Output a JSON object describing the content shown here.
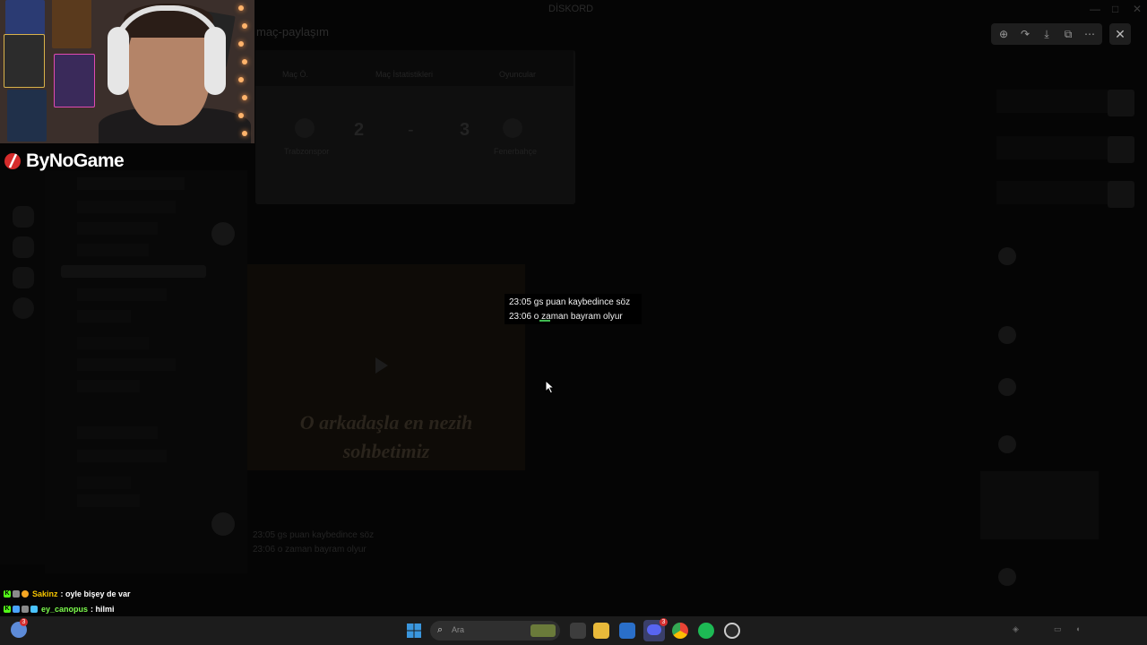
{
  "window": {
    "title": "DİSKORD"
  },
  "main": {
    "channel_header": "maç-paylaşım",
    "embed": {
      "tabs": [
        "Maç Ö.",
        "Maç İstatistikleri",
        "Oyuncular"
      ],
      "home_score": "2",
      "separator": "-",
      "away_score": "3",
      "home_team": "Trabzonspor",
      "away_team": "Fenerbahçe"
    },
    "video_caption_line1": "O arkadaşla en nezih",
    "video_caption_line2": "sohbetimiz",
    "dim_messages": [
      "23:05 gs puan kaybedince söz",
      "23:06 o zaman bayram olyur"
    ]
  },
  "tooltip": {
    "line1": "23:05 gs puan kaybedince söz",
    "line2": "23:06 o zaman bayram olyur"
  },
  "viewer_toolbar": {
    "icons": [
      "zoom-in-icon",
      "share-icon",
      "download-icon",
      "open-external-icon",
      "more-icon"
    ],
    "close_icon": "close-icon"
  },
  "overlay": {
    "brand": "ByNoGame"
  },
  "chat": [
    {
      "user": "Sakinz",
      "user_color": "#f5c400",
      "text": ": oyle bişey de var"
    },
    {
      "user": "ey_canopus",
      "user_color": "#7cfc4c",
      "text": ": hilmi"
    }
  ],
  "taskbar": {
    "search_placeholder": "Ara",
    "notification_badge": "3",
    "discord_badge": "3"
  },
  "colors": {
    "accent_green": "#3fb950",
    "windows_blue": "#3a96dd"
  }
}
